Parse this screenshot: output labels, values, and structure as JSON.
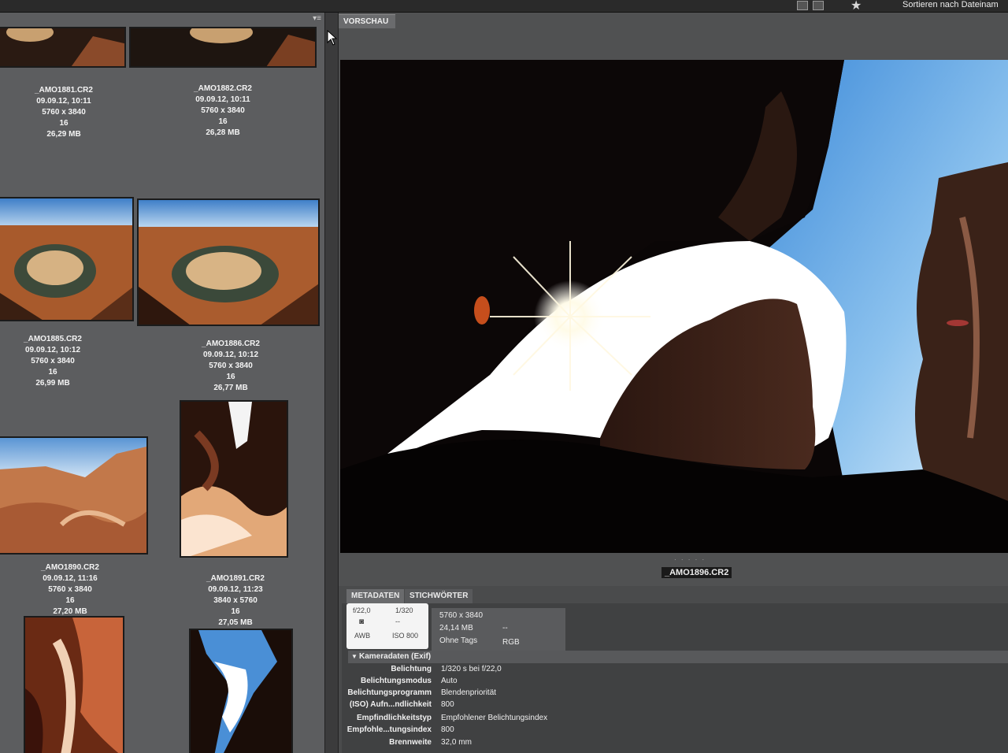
{
  "toolbar": {
    "sort_label": "Sortieren nach Dateinam",
    "icons": [
      "view-grid-icon",
      "view-list-icon",
      "star-filter-icon"
    ]
  },
  "content": {
    "items": [
      {
        "name": "_AMO1881.CR2",
        "date": "09.09.12, 10:11",
        "dims": "5760 x 3840",
        "depth": "16",
        "size": "26,29 MB"
      },
      {
        "name": "_AMO1882.CR2",
        "date": "09.09.12, 10:11",
        "dims": "5760 x 3840",
        "depth": "16",
        "size": "26,28 MB"
      },
      {
        "name": "_AMO1885.CR2",
        "date": "09.09.12, 10:12",
        "dims": "5760 x 3840",
        "depth": "16",
        "size": "26,99 MB"
      },
      {
        "name": "_AMO1886.CR2",
        "date": "09.09.12, 10:12",
        "dims": "5760 x 3840",
        "depth": "16",
        "size": "26,77 MB"
      },
      {
        "name": "_AMO1890.CR2",
        "date": "09.09.12, 11:16",
        "dims": "5760 x 3840",
        "depth": "16",
        "size": "27,20 MB"
      },
      {
        "name": "_AMO1891.CR2",
        "date": "09.09.12, 11:23",
        "dims": "3840 x 5760",
        "depth": "16",
        "size": "27,05 MB"
      }
    ]
  },
  "preview": {
    "tab_label": "VORSCHAU",
    "filename": "_AMO1896.CR2"
  },
  "metadata": {
    "tabs": [
      "METADATEN",
      "STICHWÖRTER"
    ],
    "camera_card": {
      "aperture": "f/22,0",
      "shutter": "1/320",
      "dash": "--",
      "wb": "AWB",
      "iso": "ISO 800"
    },
    "file_card": {
      "dims": "5760 x 3840",
      "size": "24,14 MB",
      "tags": "Ohne Tags",
      "dash": "--",
      "color": "RGB"
    },
    "section_title": "Kameradaten (Exif)",
    "rows": [
      {
        "key": "Belichtung",
        "value": "1/320 s bei f/22,0"
      },
      {
        "key": "Belichtungsmodus",
        "value": "Auto"
      },
      {
        "key": "Belichtungsprogramm",
        "value": "Blendenpriorität"
      },
      {
        "key": "(ISO) Aufn...ndlichkeit",
        "value": "800"
      },
      {
        "key": "Empfindlichkeitstyp",
        "value": "Empfohlener Belichtungsindex"
      },
      {
        "key": "Empfohle...tungsindex",
        "value": "800"
      },
      {
        "key": "Brennweite",
        "value": "32,0 mm"
      }
    ]
  }
}
